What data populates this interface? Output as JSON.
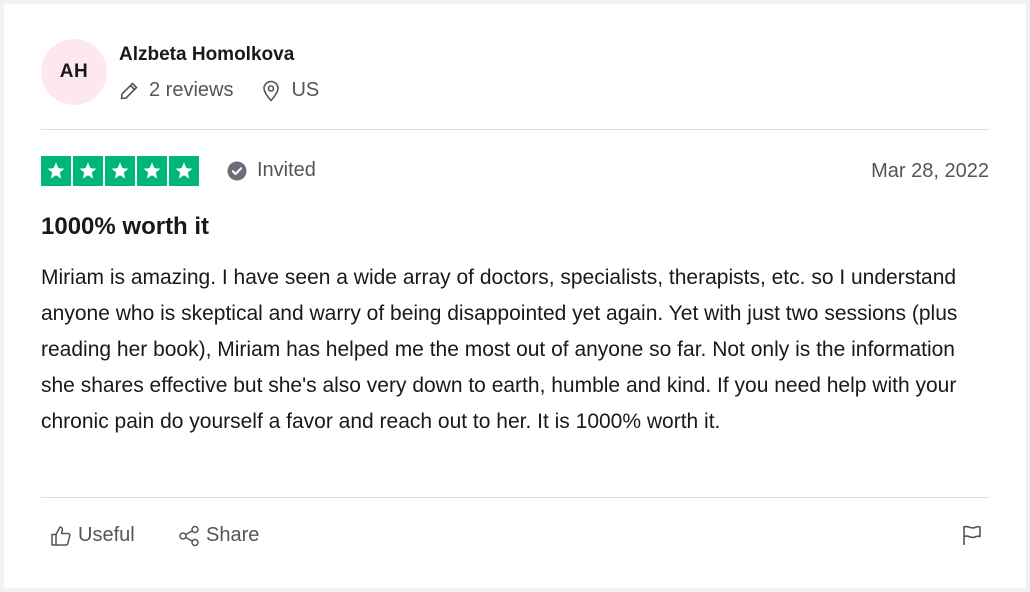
{
  "reviewer": {
    "initials": "AH",
    "name": "Alzbeta Homolkova",
    "reviews": "2 reviews",
    "country": "US"
  },
  "review": {
    "rating": 5,
    "status": "Invited",
    "date": "Mar 28, 2022",
    "title": "1000% worth it",
    "body": "Miriam is amazing. I have seen a wide array of doctors, specialists, therapists, etc. so I understand anyone who is skeptical and warry of being disappointed yet again. Yet with just two sessions (plus reading her book), Miriam has helped me the most out of anyone so far. Not only is the information she shares effective but she's also very down to earth, humble and kind. If you need help with your chronic pain do yourself a favor and reach out to her. It is 1000% worth it."
  },
  "actions": {
    "useful_label": "Useful",
    "share_label": "Share"
  },
  "icons": [
    "pencil-icon",
    "location-pin-icon",
    "check-circle-icon",
    "star-icon",
    "thumbs-up-icon",
    "share-icon",
    "flag-icon"
  ],
  "colors": {
    "star_green": "#00b67a",
    "avatar_bg": "#fde8ef",
    "muted_text": "#555555"
  }
}
